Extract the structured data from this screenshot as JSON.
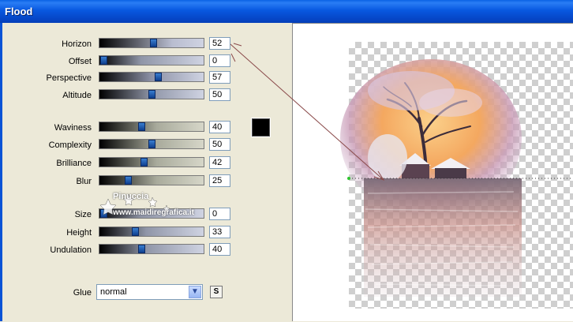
{
  "window": {
    "title": "Flood"
  },
  "controls": [
    {
      "key": "horizon",
      "label": "Horizon",
      "value": "52"
    },
    {
      "key": "offset",
      "label": "Offset",
      "value": "0"
    },
    {
      "key": "perspective",
      "label": "Perspective",
      "value": "57"
    },
    {
      "key": "altitude",
      "label": "Altitude",
      "value": "50"
    },
    {
      "key": "waviness",
      "label": "Waviness",
      "value": "40"
    },
    {
      "key": "complexity",
      "label": "Complexity",
      "value": "50"
    },
    {
      "key": "brilliance",
      "label": "Brilliance",
      "value": "42"
    },
    {
      "key": "blur",
      "label": "Blur",
      "value": "25"
    },
    {
      "key": "size",
      "label": "Size",
      "value": "0"
    },
    {
      "key": "height",
      "label": "Height",
      "value": "33"
    },
    {
      "key": "undulation",
      "label": "Undulation",
      "value": "40"
    }
  ],
  "color": {
    "label": "color-swatch",
    "value": "#000000"
  },
  "glue": {
    "label": "Glue",
    "value": "normal",
    "s_button": "S"
  },
  "watermark": {
    "line1": "Pinuccia",
    "line2": "www.maidiregrafica.it"
  }
}
